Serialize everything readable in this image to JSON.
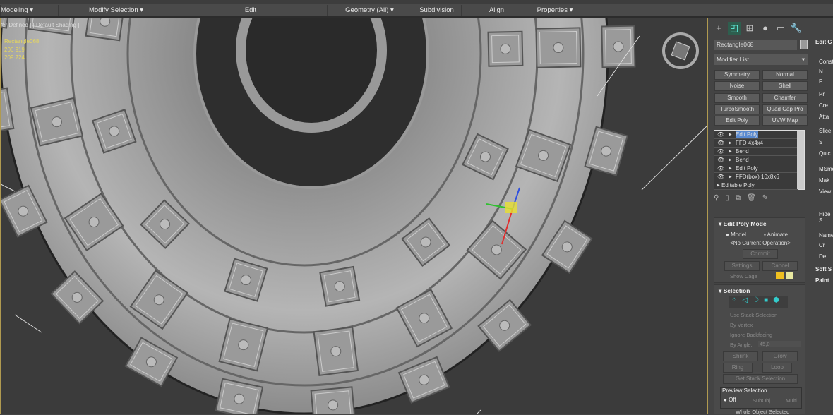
{
  "ribbon": {
    "groups": [
      "Modeling ▾",
      "Modify Selection ▾",
      "Edit",
      "Geometry (All) ▾",
      "Subdivision",
      "Align",
      "Properties ▾"
    ]
  },
  "viewport": {
    "label": "er Defined ] [ Default Shading ]",
    "object_name": "Rectangle068",
    "stat1": "206 919",
    "stat2": "209 224"
  },
  "panel": {
    "tabs": [
      "create-icon",
      "modify-icon",
      "hierarchy-icon",
      "motion-icon",
      "display-icon",
      "utilities-icon"
    ],
    "object_name": "Rectangle068",
    "color_swatch": "#9a9a9a",
    "modifier_list": "Modifier List",
    "modifier_buttons": [
      "Symmetry",
      "Normal",
      "Noise",
      "Shell",
      "Smooth",
      "Chamfer",
      "TurboSmooth",
      "Quad Cap Pro",
      "Edit Poly",
      "UVW Map"
    ],
    "stack": [
      "Edit Poly",
      "FFD 4x4x4",
      "Bend",
      "Bend",
      "Edit Poly",
      "FFD(box) 10x8x6",
      "Editable Poly"
    ],
    "edit_poly_mode": {
      "title": "Edit Poly Mode",
      "model": "Model",
      "animate": "Animate",
      "operation": "<No Current Operation>",
      "commit": "Commit",
      "settings": "Settings",
      "cancel": "Cancel",
      "show_cage": "Show Cage",
      "cage_colors": [
        "#f0c020",
        "#e8e8a0"
      ]
    },
    "selection": {
      "title": "Selection",
      "use_stack": "Use Stack Selection",
      "by_vertex": "By Vertex",
      "ignore_backfacing": "Ignore Backfacing",
      "by_angle": "By Angle:",
      "angle": "45,0",
      "shrink": "Shrink",
      "grow": "Grow",
      "ring": "Ring",
      "loop": "Loop",
      "get_stack": "Get Stack Selection",
      "preview": "Preview Selection",
      "off": "Off",
      "subobj": "SubObj",
      "multi": "Multi",
      "whole": "Whole Object Selected"
    },
    "right_col": [
      "Edit G",
      "Const",
      "N",
      "F",
      "Pr",
      "Cre",
      "Atta",
      "Slice",
      "S",
      "Quic",
      "MSmo",
      "Mak",
      "View",
      "Hide S",
      "Name",
      "Cr",
      "De",
      "Soft S",
      "Paint"
    ]
  }
}
